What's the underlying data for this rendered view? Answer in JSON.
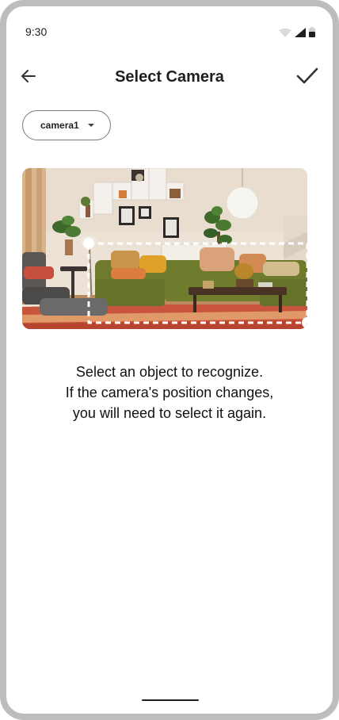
{
  "status_bar": {
    "time": "9:30"
  },
  "app_bar": {
    "title": "Select Camera"
  },
  "camera_select": {
    "selected": "camera1"
  },
  "instructions": {
    "lines": [
      "Select an object to recognize.",
      "If the camera's position changes,",
      "you will need to select it again."
    ]
  },
  "icons": {
    "back": "arrow-back-icon",
    "confirm": "check-icon",
    "dropdown": "caret-down-icon",
    "wifi": "wifi-icon",
    "signal": "signal-icon",
    "battery": "battery-icon"
  }
}
